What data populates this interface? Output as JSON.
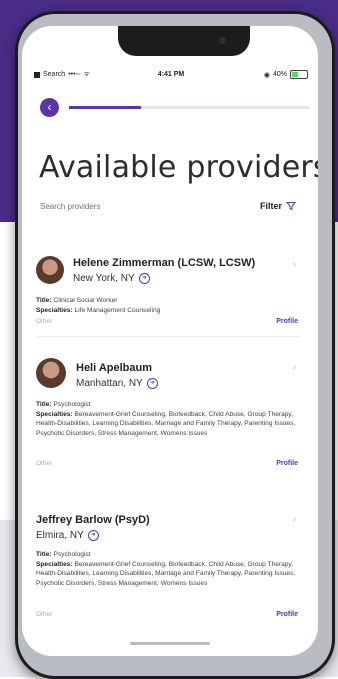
{
  "status_bar": {
    "carrier": "Search",
    "time": "4:41 PM",
    "battery": "40%"
  },
  "progress": {
    "fraction": 0.3
  },
  "header": {
    "title": "Available providers."
  },
  "search": {
    "placeholder": "Search providers"
  },
  "filter": {
    "label": "Filter"
  },
  "providers": [
    {
      "name": "Helene Zimmerman (LCSW, LCSW)",
      "location": "New York, NY",
      "title_label": "Title:",
      "title": "Clinical Social Worker",
      "specialties_label": "Specialties:",
      "specialties": "Life Management Counseling",
      "tag": "Other",
      "profile_label": "Profile"
    },
    {
      "name": "Heli Apelbaum",
      "location": "Manhattan, NY",
      "title_label": "Title:",
      "title": "Psychologist",
      "specialties_label": "Specialties:",
      "specialties": "Bereavement-Grief Counseling, Biofeedback, Child Abuse, Group Therapy, Health-Disabilities, Learning Disabilities, Marriage and Family Therapy, Parenting Issues, Psychotic Disorders, Stress Management, Womens Issues",
      "tag": "Other",
      "profile_label": "Profile"
    },
    {
      "name": "Jeffrey Barlow (PsyD)",
      "location": "Elmira, NY",
      "title_label": "Title:",
      "title": "Psychologist",
      "specialties_label": "Specialties:",
      "specialties": "Bereavement-Grief Counseling, Biofeedback, Child Abuse, Group Therapy, Health-Disabilities, Learning Disabilities, Marriage and Family Therapy, Parenting Issues, Psychotic Disorders, Stress Management, Womens Issues",
      "tag": "Other",
      "profile_label": "Profile"
    }
  ],
  "icons": {
    "back": "arrow-left-icon",
    "filter": "funnel-icon",
    "location": "location-arrow-icon",
    "chevron": "chevron-right-icon"
  },
  "colors": {
    "accent": "#5f35a6",
    "background_purple": "#4a2d86"
  }
}
